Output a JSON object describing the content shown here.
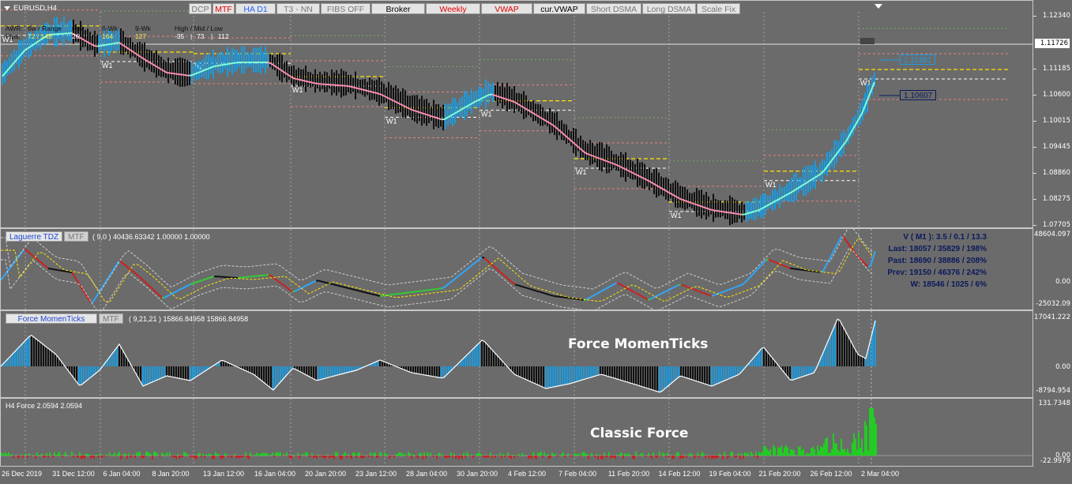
{
  "window": {
    "symbol_tf": "EURUSD,H4"
  },
  "toolbar": [
    {
      "label": "DCP",
      "color": "#777777"
    },
    {
      "label": "MTF",
      "color": "#e60000"
    },
    {
      "label": "HA D1",
      "color": "#1e64ff"
    },
    {
      "label": "T3 - NN",
      "color": "#777777"
    },
    {
      "label": "FIBS OFF",
      "color": "#777777"
    },
    {
      "label": "Broker",
      "color": "#000000"
    },
    {
      "label": "Weekly",
      "color": "#e60000"
    },
    {
      "label": "VWAP",
      "color": "#e60000"
    },
    {
      "label": "cur.VWAP",
      "color": "#000000"
    },
    {
      "label": "Short DSMA",
      "color": "#777777"
    },
    {
      "label": "Long DSMA",
      "color": "#777777"
    },
    {
      "label": "Scale Fix",
      "color": "#777777"
    }
  ],
  "awr": {
    "row1": [
      "AWR:",
      "6w / Range",
      "Rev",
      "6-Wk",
      "9-Wk",
      "High / Mid / Low"
    ],
    "row2_label": "Pips:",
    "row2_vals": [
      "72 / 148",
      "26",
      "164",
      "127"
    ],
    "hml": [
      "-35",
      "73",
      "112"
    ]
  },
  "main": {
    "price_levels": [
      "1.12340",
      "1.11726",
      "1.11185",
      "1.10600",
      "1.10015",
      "1.09445",
      "1.08860",
      "1.08275",
      "1.07705"
    ],
    "current_price": "1.11726",
    "label_upper": "1.11381",
    "label_lower": "1.10607",
    "week_marker": "W1"
  },
  "laguerre": {
    "title": "Laguerre TDZ",
    "mtf": "MTF",
    "params": "( 9,0 ) 40436.63342 1.00000 1.00000",
    "scale": [
      "48604.097",
      "0.00",
      "-25032.09"
    ],
    "stats": [
      "V ( M1 ): 3.5 / 0.1 / 13.3",
      "Last: 18057 / 35829 / 198%",
      "Past: 18690 / 38886 / 208%",
      "Prev: 19150 / 46376 / 242%",
      "W: 18546 / 1025 / 6%"
    ]
  },
  "force_mt": {
    "title": "Force MomenTicks",
    "mtf": "MTF",
    "params": "( 9,21,21 ) 15866.84958 15866.84958",
    "watermark": "Force MomenTicks",
    "scale": [
      "17041.222",
      "0.00",
      "-8794.954"
    ]
  },
  "classic": {
    "title": "H4 Force 2.0594 2.0594",
    "watermark": "Classic Force",
    "scale": [
      "131.7348",
      "0.00",
      "-22.9979"
    ]
  },
  "time_labels": [
    "26 Dec 2019",
    "31 Dec 12:00",
    "6 Jan 04:00",
    "8 Jan 20:00",
    "13 Jan 12:00",
    "16 Jan 04:00",
    "20 Jan 20:00",
    "23 Jan 12:00",
    "28 Jan 04:00",
    "30 Jan 20:00",
    "4 Feb 12:00",
    "7 Feb 04:00",
    "11 Feb 20:00",
    "14 Feb 12:00",
    "19 Feb 04:00",
    "21 Feb 20:00",
    "26 Feb 12:00",
    "2 Mar 04:00"
  ],
  "colors": {
    "up": "#1a9be0",
    "down": "#111111",
    "ma_up": "#7fffd4",
    "ma_down": "#ff8fb0",
    "grid": "#a0a0a0",
    "green": "#22cc22",
    "red": "#cc2222"
  }
}
